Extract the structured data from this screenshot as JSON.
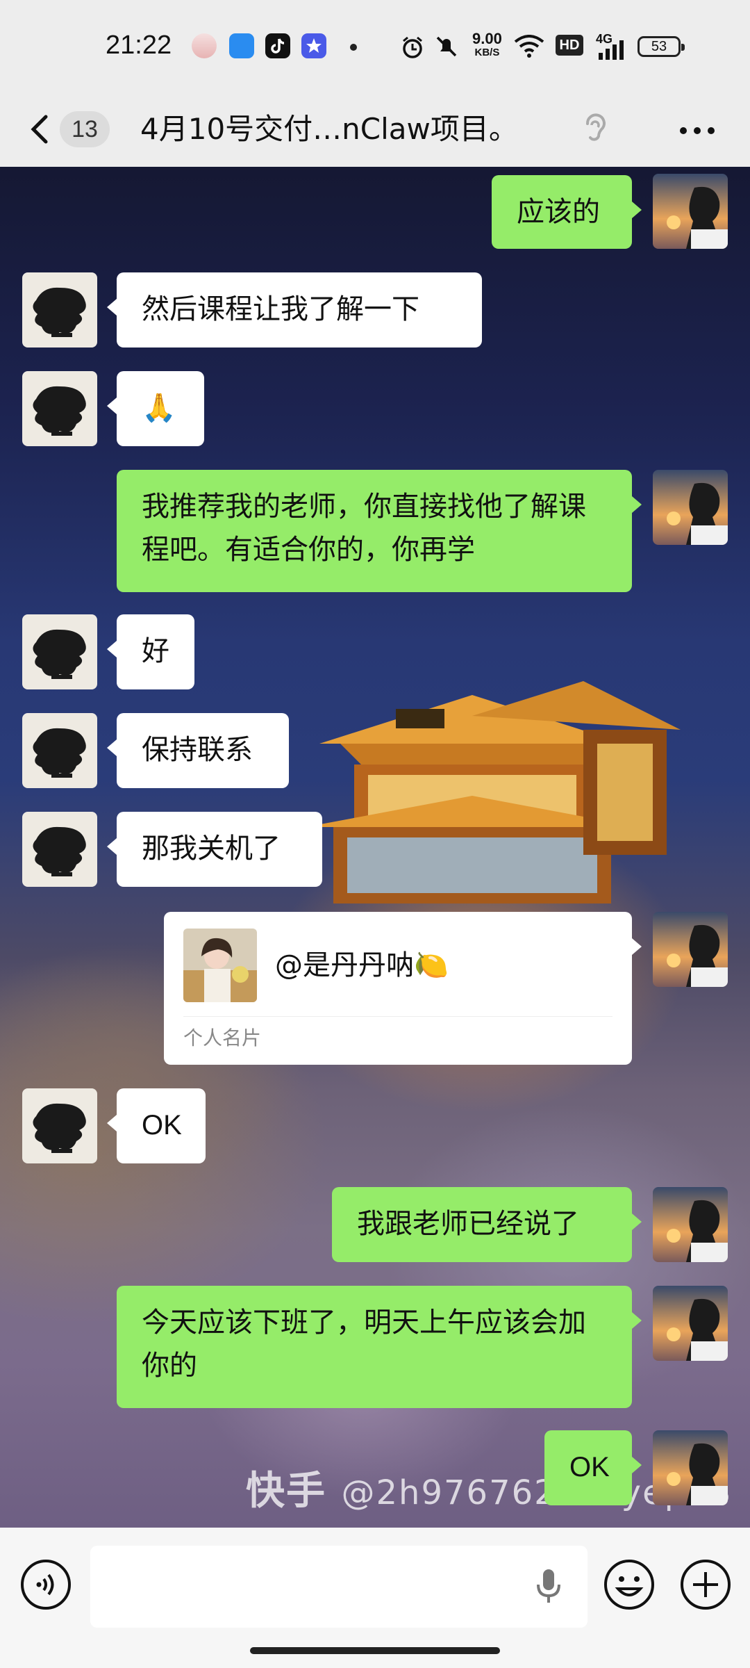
{
  "status_bar": {
    "time": "21:22",
    "net_speed": "9.00",
    "net_unit": "KB/S",
    "hd_label": "HD",
    "signal_label": "4G",
    "battery": "53",
    "icons": [
      "app-icon-avatar",
      "app-icon-blue",
      "tiktok-icon",
      "app-icon-star",
      "alarm-icon",
      "mute-icon",
      "wifi-icon",
      "signal-icon"
    ]
  },
  "header": {
    "unread_count": "13",
    "title": "4月10号交付…nClaw项目。"
  },
  "messages": [
    {
      "side": "sent",
      "text": "应该的"
    },
    {
      "side": "recv",
      "text": "然后课程让我了解一下"
    },
    {
      "side": "recv",
      "text": "🙏"
    },
    {
      "side": "sent",
      "text": "我推荐我的老师，你直接找他了解课程吧。有适合你的，你再学"
    },
    {
      "side": "recv",
      "text": "好"
    },
    {
      "side": "recv",
      "text": "保持联系"
    },
    {
      "side": "recv",
      "text": "那我关机了"
    },
    {
      "side": "sent",
      "type": "card",
      "name": "@是丹丹呐🍋",
      "label": "个人名片"
    },
    {
      "side": "recv",
      "text": "OK"
    },
    {
      "side": "sent",
      "text": "我跟老师已经说了"
    },
    {
      "side": "sent",
      "text": "今天应该下班了，明天上午应该会加你的"
    },
    {
      "side": "sent",
      "text": "OK"
    }
  ],
  "watermark": {
    "brand": "快手",
    "handle": "@2h976762 kaiyep98"
  },
  "input_bar": {
    "placeholder": ""
  },
  "colors": {
    "sent_bubble": "#95ec69",
    "recv_bubble": "#ffffff",
    "header_bg": "#ededed"
  }
}
